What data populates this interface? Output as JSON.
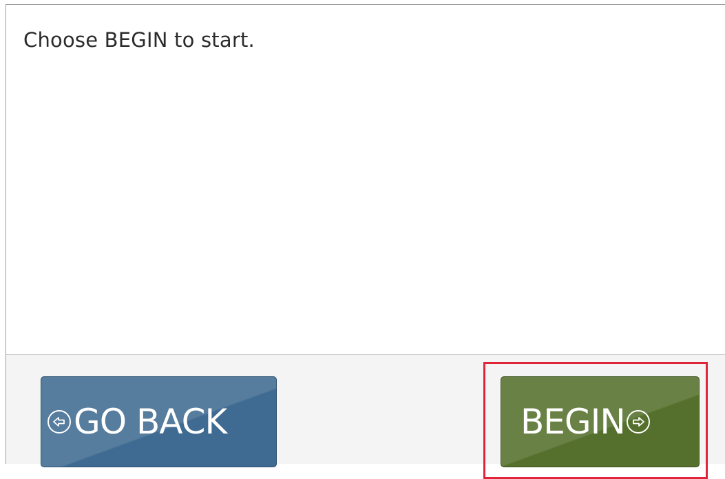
{
  "content": {
    "instruction": "Choose BEGIN to start."
  },
  "footer": {
    "back_label": "GO BACK",
    "back_icon": "arrow-left-circle-icon",
    "begin_label": "BEGIN",
    "begin_icon": "arrow-right-circle-icon"
  },
  "colors": {
    "back_button": "#3f6a91",
    "begin_button": "#55702c",
    "highlight": "#e0243a",
    "footer_bg": "#f4f4f4"
  }
}
